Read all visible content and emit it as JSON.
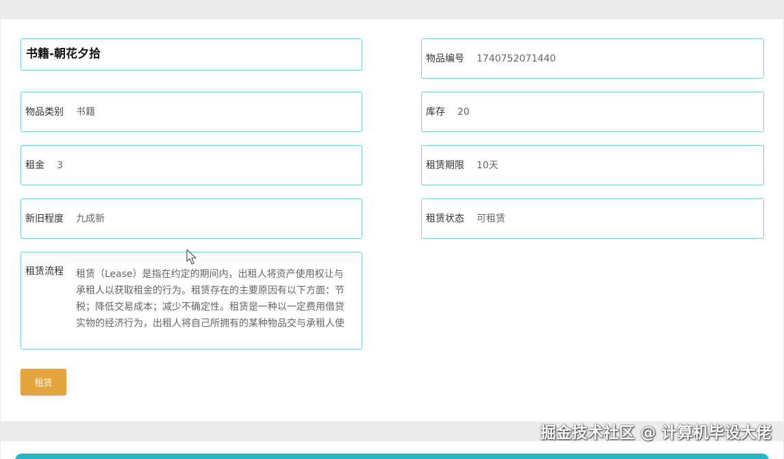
{
  "product": {
    "title": "书籍-朝花夕拾"
  },
  "fields": {
    "item_number": {
      "label": "物品编号",
      "value": "1740752071440"
    },
    "category": {
      "label": "物品类别",
      "value": "书籍"
    },
    "stock": {
      "label": "库存",
      "value": "20"
    },
    "rent": {
      "label": "租金",
      "value": "3"
    },
    "lease_term": {
      "label": "租赁期限",
      "value": "10天"
    },
    "condition": {
      "label": "新旧程度",
      "value": "九成新"
    },
    "lease_status": {
      "label": "租赁状态",
      "value": "可租赁"
    },
    "lease_process": {
      "label": "租赁流程",
      "value": "租赁（Lease）是指在约定的期间内，出租人将资产使用权让与承租人以获取租金的行为。租赁存在的主要原因有以下方面：节税；降低交易成本；减少不确定性。租赁是一种以一定费用借贷实物的经济行为，出租人将自己所拥有的某种物品交与承租人使"
    }
  },
  "actions": {
    "rent_button": "租赁"
  },
  "watermark": {
    "text": "掘金技术社区 @ 计算机毕设大佬"
  },
  "icons": {
    "cursor": "mouse-pointer-icon"
  },
  "colors": {
    "field_border": "#79cdd7",
    "button_background": "#e5a43d",
    "bottom_accent": "#24b7c7"
  }
}
